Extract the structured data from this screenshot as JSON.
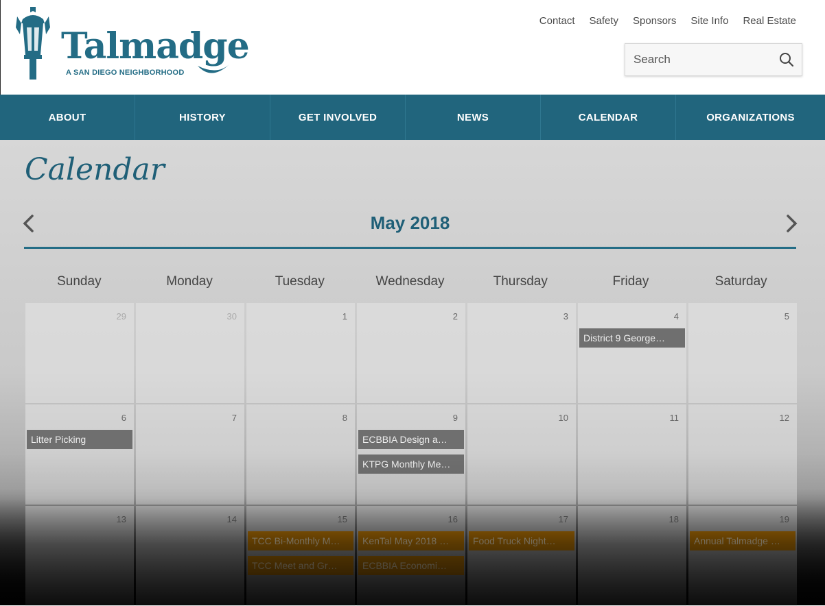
{
  "header": {
    "logo_word": "Talmadge",
    "logo_sub": "A SAN DIEGO NEIGHBORHOOD",
    "brand_color": "#236c85",
    "top_links": [
      "Contact",
      "Safety",
      "Sponsors",
      "Site Info",
      "Real Estate"
    ],
    "search_placeholder": "Search",
    "search_icon": "search-icon"
  },
  "nav": {
    "items": [
      "ABOUT",
      "HISTORY",
      "GET INVOLVED",
      "NEWS",
      "CALENDAR",
      "ORGANIZATIONS"
    ],
    "background": "#21657d"
  },
  "page": {
    "title": "Calendar"
  },
  "calendar": {
    "month_label": "May 2018",
    "prev_icon": "chevron-left-icon",
    "next_icon": "chevron-right-icon",
    "weekdays": [
      "Sunday",
      "Monday",
      "Tuesday",
      "Wednesday",
      "Thursday",
      "Friday",
      "Saturday"
    ],
    "weeks": [
      [
        {
          "day": "29",
          "other": true,
          "events": []
        },
        {
          "day": "30",
          "other": true,
          "events": []
        },
        {
          "day": "1",
          "events": []
        },
        {
          "day": "2",
          "events": []
        },
        {
          "day": "3",
          "events": []
        },
        {
          "day": "4",
          "events": [
            {
              "title": "District 9 George…",
              "color": "gray"
            }
          ]
        },
        {
          "day": "5",
          "events": []
        }
      ],
      [
        {
          "day": "6",
          "events": [
            {
              "title": "Litter Picking",
              "color": "gray"
            }
          ]
        },
        {
          "day": "7",
          "events": []
        },
        {
          "day": "8",
          "events": []
        },
        {
          "day": "9",
          "events": [
            {
              "title": "ECBBIA Design a…",
              "color": "gray"
            },
            {
              "title": "KTPG Monthly Me…",
              "color": "gray"
            }
          ]
        },
        {
          "day": "10",
          "events": []
        },
        {
          "day": "11",
          "events": []
        },
        {
          "day": "12",
          "events": []
        }
      ],
      [
        {
          "day": "13",
          "events": []
        },
        {
          "day": "14",
          "events": []
        },
        {
          "day": "15",
          "events": [
            {
              "title": "TCC Bi-Monthly M…",
              "color": "gold"
            },
            {
              "title": "TCC Meet and Gr…",
              "color": "gold"
            }
          ]
        },
        {
          "day": "16",
          "events": [
            {
              "title": "KenTal May 2018 …",
              "color": "gold"
            },
            {
              "title": "ECBBIA Economi…",
              "color": "gold"
            }
          ]
        },
        {
          "day": "17",
          "events": [
            {
              "title": "Food Truck Night…",
              "color": "gold"
            }
          ]
        },
        {
          "day": "18",
          "events": []
        },
        {
          "day": "19",
          "events": [
            {
              "title": "Annual Talmadge …",
              "color": "gold"
            }
          ]
        }
      ]
    ]
  }
}
